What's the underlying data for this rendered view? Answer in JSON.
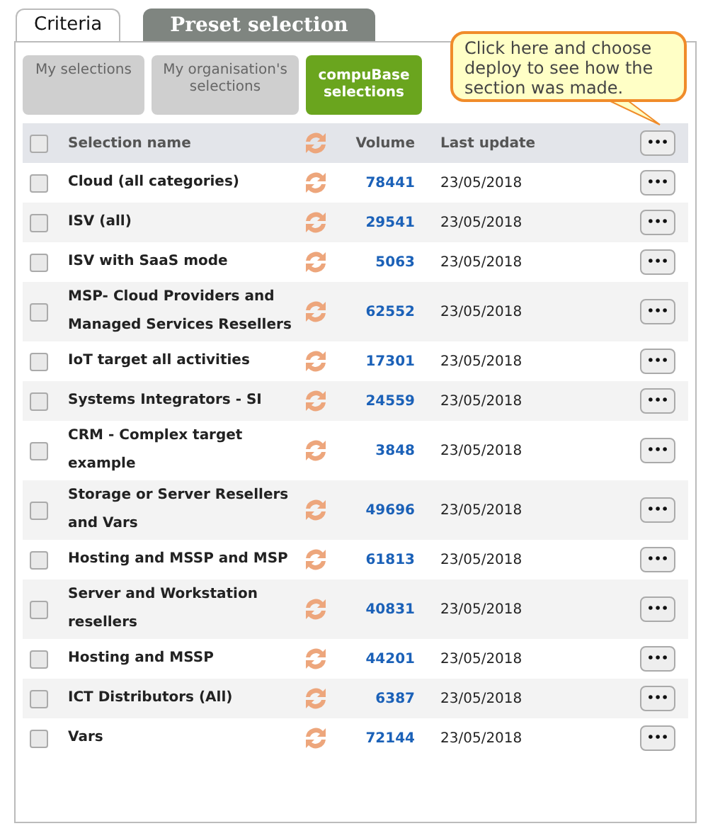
{
  "tabs": [
    {
      "label": "Criteria",
      "selected": false
    },
    {
      "label": "Preset selection",
      "selected": true
    }
  ],
  "sources": [
    {
      "label": "My selections",
      "selected": false
    },
    {
      "label": "My organisation's selections",
      "selected": false
    },
    {
      "label": "compuBase selections",
      "selected": true
    }
  ],
  "callout": {
    "text": "Click here and choose deploy to see how the section was made."
  },
  "table": {
    "columns": [
      "Selection name",
      "Volume",
      "Last update"
    ],
    "header_checked": false,
    "header_menu": "•••",
    "rows": [
      {
        "name": "Cloud (all categories)",
        "volume": "78441",
        "date": "23/05/2018",
        "checked": false,
        "menu": "•••"
      },
      {
        "name": "ISV (all)",
        "volume": "29541",
        "date": "23/05/2018",
        "checked": false,
        "menu": "•••"
      },
      {
        "name": "ISV with SaaS mode",
        "volume": "5063",
        "date": "23/05/2018",
        "checked": false,
        "menu": "•••"
      },
      {
        "name": "MSP- Cloud Providers and Managed Services Resellers",
        "volume": "62552",
        "date": "23/05/2018",
        "checked": false,
        "menu": "•••"
      },
      {
        "name": "IoT target all activities",
        "volume": "17301",
        "date": "23/05/2018",
        "checked": false,
        "menu": "•••"
      },
      {
        "name": "Systems Integrators - SI",
        "volume": "24559",
        "date": "23/05/2018",
        "checked": false,
        "menu": "•••"
      },
      {
        "name": "CRM - Complex target example",
        "volume": "3848",
        "date": "23/05/2018",
        "checked": false,
        "menu": "•••"
      },
      {
        "name": "Storage or Server Resellers and Vars",
        "volume": "49696",
        "date": "23/05/2018",
        "checked": false,
        "menu": "•••"
      },
      {
        "name": "Hosting and MSSP and MSP",
        "volume": "61813",
        "date": "23/05/2018",
        "checked": false,
        "menu": "•••"
      },
      {
        "name": "Server and Workstation resellers",
        "volume": "40831",
        "date": "23/05/2018",
        "checked": false,
        "menu": "•••"
      },
      {
        "name": "Hosting and MSSP",
        "volume": "44201",
        "date": "23/05/2018",
        "checked": false,
        "menu": "•••"
      },
      {
        "name": "ICT Distributors (All)",
        "volume": "6387",
        "date": "23/05/2018",
        "checked": false,
        "menu": "•••"
      },
      {
        "name": "Vars",
        "volume": "72144",
        "date": "23/05/2018",
        "checked": false,
        "menu": "•••"
      }
    ]
  }
}
